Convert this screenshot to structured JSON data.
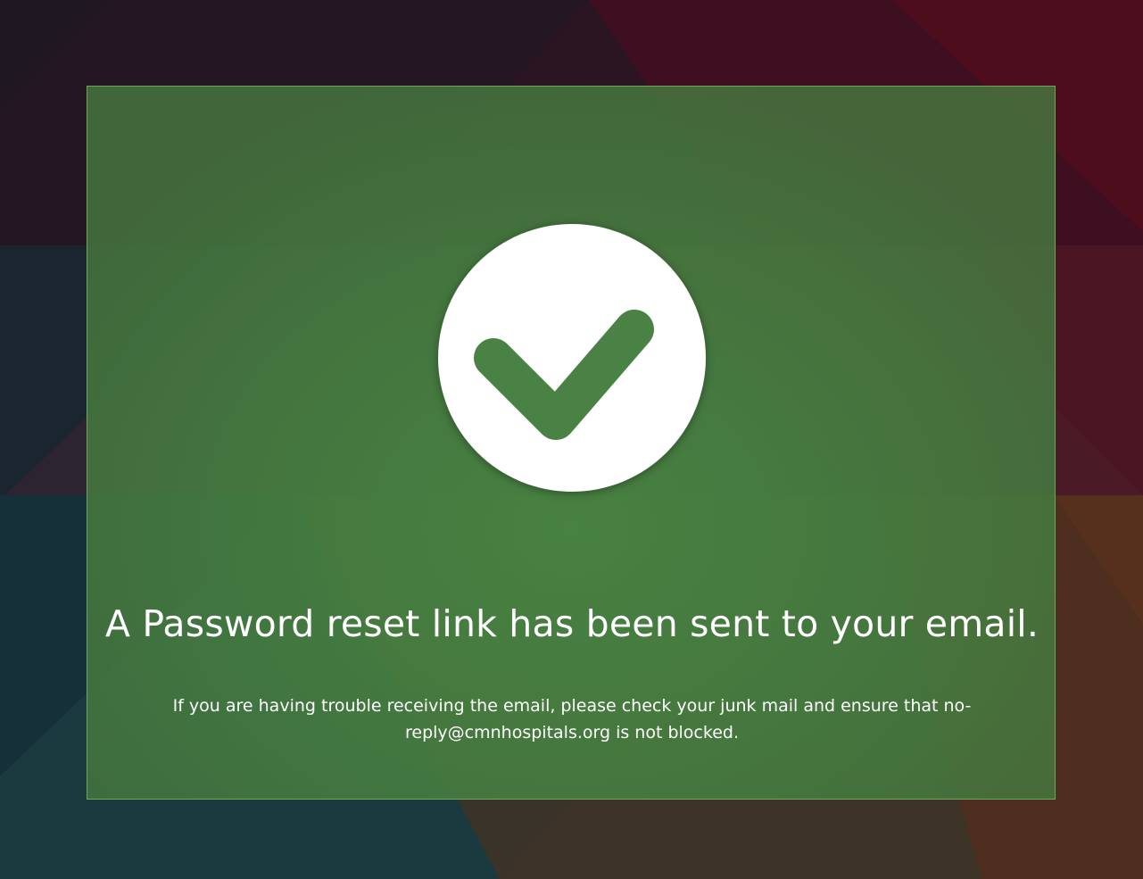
{
  "confirmation": {
    "icon": "checkmark-icon",
    "headline": "A Password reset link has been sent to your email.",
    "note": "If you are having trouble receiving the email, please check your junk mail and ensure that no-reply@cmnhospitals.org is not blocked."
  },
  "colors": {
    "panel": "#4a8444",
    "panel_border": "#6aa85a",
    "icon_circle": "#ffffff",
    "text": "#ffffff"
  }
}
